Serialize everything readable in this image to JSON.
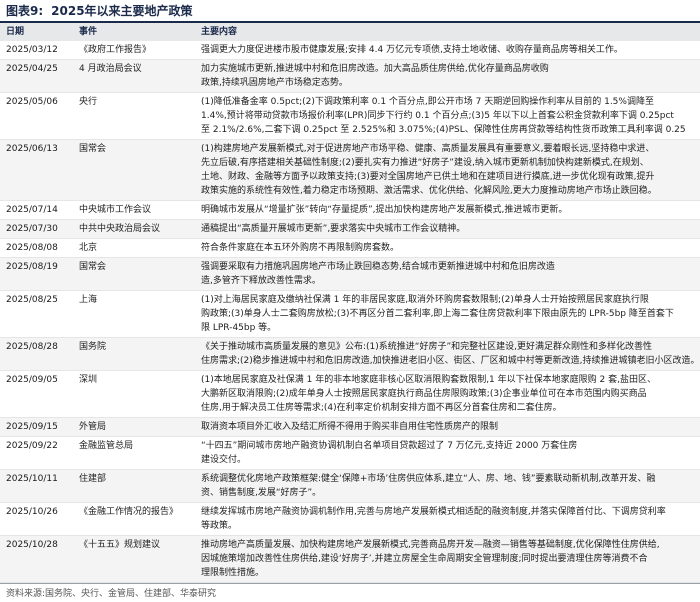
{
  "figure": {
    "label": "图表9:",
    "title": "2025年以来主要地产政策"
  },
  "table": {
    "headers": [
      "日期",
      "事件",
      "主要内容"
    ],
    "rows": [
      {
        "date": "2025/03/12",
        "event": "《政府工作报告》",
        "lines": [
          "强调更大力度促进楼市股市健康发展;安排 4.4 万亿元专项债,支持土地收储、收购存量商品房等相关工作。"
        ]
      },
      {
        "date": "2025/04/25",
        "event": "4 月政治局会议",
        "lines": [
          "加力实施城市更新,推进城中村和危旧房改造。加大高品质住房供给,优化存量商品房收购",
          "政策,持续巩固房地产市场稳定态势。"
        ]
      },
      {
        "date": "2025/05/06",
        "event": "央行",
        "lines": [
          "(1)降低准备金率 0.5pct;(2)下调政策利率 0.1 个百分点,即公开市场 7 天期逆回购操作利率从目前的 1.5%调降至",
          "1.4%,预计将带动贷款市场报价利率(LPR)同步下行约 0.1 个百分点;(3)5 年以下以上首套公积金贷款利率下调 0.25pct",
          "至 2.1%/2.6%,二套下调 0.25pct 至 2.525%和 3.075%;(4)PSL、保障性住房再贷款等结构性货币政策工具利率调 0.25"
        ]
      },
      {
        "date": "2025/06/13",
        "event": "国常会",
        "lines": [
          "(1)构建房地产发展新模式,对于促进房地产市场平稳、健康、高质量发展具有重要意义,要着眼长远,坚持稳中求进、",
          "先立后破,有序搭建相关基础性制度;(2)要扎实有力推进“好房子”建设,纳入城市更新机制加快构建新模式,在规划、",
          "土地、财政、金融等方面予以政策支持;(3)要对全国房地产已供土地和在建项目进行摸底,进一步优化现有政策,提升",
          "政策实施的系统性有效性,着力稳定市场预期、激活需求、优化供给、化解风险,更大力度推动房地产市场止跌回稳。"
        ]
      },
      {
        "date": "2025/07/14",
        "event": "中央城市工作会议",
        "lines": [
          "明确城市发展从“增量扩张”转向“存量提质”,提出加快构建房地产发展新模式,推进城市更新。"
        ]
      },
      {
        "date": "2025/07/30",
        "event": "中共中央政治局会议",
        "lines": [
          "通稿提出“高质量开展城市更新”,要求落实中央城市工作会议精神。"
        ]
      },
      {
        "date": "2025/08/08",
        "event": "北京",
        "lines": [
          "符合条件家庭在本五环外购房不再限制购房套数。"
        ]
      },
      {
        "date": "2025/08/19",
        "event": "国常会",
        "lines": [
          "强调要采取有力措施巩固房地产市场止跌回稳态势,结合城市更新推进城中村和危旧房改造",
          "造,多管齐下释放改善性需求。"
        ]
      },
      {
        "date": "2025/08/25",
        "event": "上海",
        "lines": [
          "(1)对上海居民家庭及缴纳社保满 1 年的非居民家庭,取消外环购房套数限制;(2)单身人士开始按照居民家庭执行限",
          "购政策;(3)单身人士二套购房放松;(3)不再区分首二套利率,即上海二套住房贷款利率下限由原先的 LPR-5bp 降至首套下",
          "限 LPR-45bp 等。"
        ]
      },
      {
        "date": "2025/08/28",
        "event": "国务院",
        "lines": [
          "《关于推动城市高质量发展的意见》公布:(1)系统推进“好房子”和完整社区建设,更好满足群众刚性和多样化改善性",
          "住房需求;(2)稳步推进城中村和危旧房改造,加快推进老旧小区、街区、厂区和城中村等更新改造,持续推进城镇老旧小区改造。"
        ]
      },
      {
        "date": "2025/09/05",
        "event": "深圳",
        "lines": [
          "(1)本地居民家庭及社保满 1 年的非本地家庭非核心区取消限购套数限制,1 年以下社保本地家庭限购 2 套,盐田区、",
          "大鹏新区取消限购;(2)成年单身人士按照居民家庭执行商品住房限购政策;(3)企事业单位可在本市范围内购买商品",
          "住房,用于解决员工住房等需求;(4)在利率定价机制安排方面不再区分首套住房和二套住房。"
        ]
      },
      {
        "date": "2025/09/15",
        "event": "外管局",
        "lines": [
          "取消资本项目外汇收入及结汇所得不得用于购买非自用住宅性质房产的限制"
        ]
      },
      {
        "date": "2025/09/22",
        "event": "金融监管总局",
        "lines": [
          "“十四五”期间城市房地产融资协调机制白名单项目贷款超过了 7 万亿元,支持近 2000 万套住房",
          "建设交付。"
        ]
      },
      {
        "date": "2025/10/11",
        "event": "住建部",
        "lines": [
          "系统调整优化房地产政策框架:健全‘保障+市场’住房供应体系,建立“人、房、地、钱”要素联动新机制,改革开发、融",
          "资、销售制度,发展“好房子”。"
        ]
      },
      {
        "date": "2025/10/26",
        "event": "《金融工作情况的报告》",
        "lines": [
          "继续发挥城市房地产融资协调机制作用,完善与房地产发展新模式相适配的融资制度,并落实保障首付比、下调房贷利率",
          "等政策。"
        ]
      },
      {
        "date": "2025/10/28",
        "event": "《十五五》规划建议",
        "lines": [
          "推动房地产高质量发展、加快构建房地产发展新模式,完善商品房开发—融资—销售等基础制度,优化保障性住房供给,",
          "因城施策增加改善性住房供给,建设‘好房子’,并建立房屋全生命周期安全管理制度;同时提出要清理住房等消费不合",
          "理限制性措施。"
        ]
      }
    ]
  },
  "source": "资料来源:国务院、央行、金管局、住建部、华泰研究"
}
